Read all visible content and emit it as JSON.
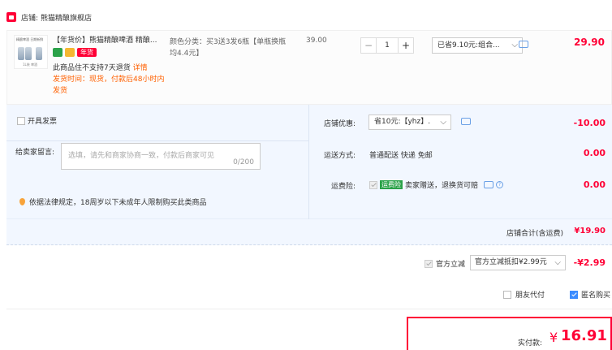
{
  "store": {
    "label": "店铺:",
    "name": "熊猫精酿旗舰店"
  },
  "product": {
    "thumb_top": "精酿啤酒 日期新鲜",
    "thumb_bottom": "1L装 啤酒",
    "title": "【年货价】熊猫精酿啤酒 精酿...",
    "badge_tag": "年货",
    "warning_1": "此商品住不支持7天退货",
    "warning_2": "详情",
    "shipping": "发货时间：现货，付款后48小时内发货",
    "sku": "颜色分类：买3送3发6瓶【单瓶换瓶均4.4元】",
    "unit_price": "39.00",
    "qty_minus": "−",
    "qty": "1",
    "qty_plus": "+",
    "promo_label": "已省9.10元:组合...",
    "line_total": "29.90"
  },
  "invoice": {
    "label": "开具发票"
  },
  "message": {
    "label": "给卖家留言:",
    "placeholder": "选填，请先和商家协商一致，付款后商家可见",
    "count": "0/200"
  },
  "law_notice": "依据法律规定，18周岁以下未成年人限制购买此类商品",
  "store_discount": {
    "label": "店铺优惠:",
    "value": "省10元:【yhz】.",
    "amount": "-10.00"
  },
  "delivery": {
    "label": "运送方式:",
    "value": "普通配送 快递 免邮",
    "amount": "0.00"
  },
  "insurance": {
    "label": "运费险:",
    "tag": "运费险",
    "value": "卖家赠送，退换货可赔",
    "amount": "0.00"
  },
  "subtotal": {
    "label": "店铺合计(含运费)",
    "value": "¥19.90"
  },
  "official": {
    "label": "官方立减",
    "select": "官方立减抵扣¥2.99元",
    "amount": "-¥2.99"
  },
  "options": {
    "friend_pay": "朋友代付",
    "anonymous": "匿名购买"
  },
  "payment": {
    "label": "实付款:",
    "currency": "¥",
    "value": "16.91"
  },
  "colors": {
    "accent": "#ff0036",
    "panel": "#f2f7ff",
    "check": "#3b8cff"
  }
}
